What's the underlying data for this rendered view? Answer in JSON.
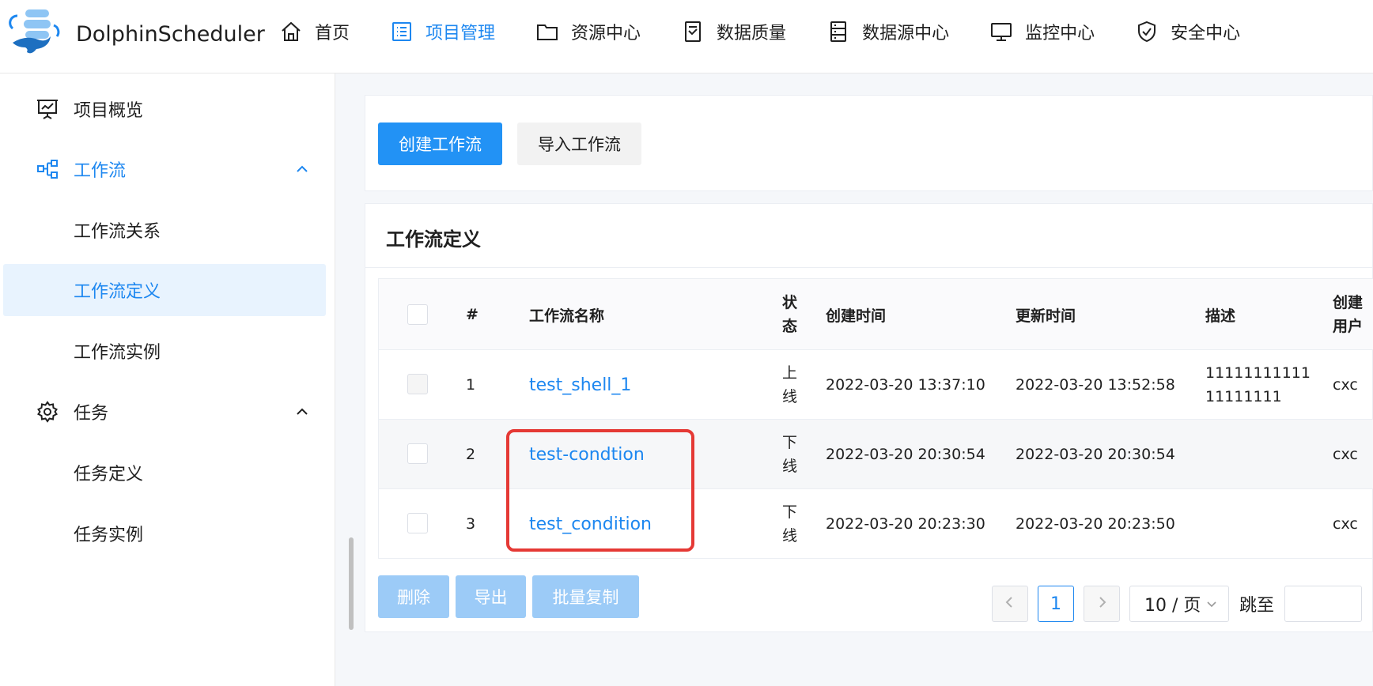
{
  "app": {
    "name": "DolphinScheduler"
  },
  "colors": {
    "accent": "#1d87f0",
    "primary_button": "#2292f5",
    "disabled_button": "#9ccbf7",
    "highlight": "#e53935"
  },
  "nav": [
    {
      "label": "首页",
      "icon": "home-icon"
    },
    {
      "label": "项目管理",
      "icon": "list-icon",
      "active": true
    },
    {
      "label": "资源中心",
      "icon": "folder-icon"
    },
    {
      "label": "数据质量",
      "icon": "document-check-icon"
    },
    {
      "label": "数据源中心",
      "icon": "database-icon"
    },
    {
      "label": "监控中心",
      "icon": "monitor-icon"
    },
    {
      "label": "安全中心",
      "icon": "shield-icon"
    }
  ],
  "sidebar": {
    "overview": "项目概览",
    "workflow": "工作流",
    "workflow_relation": "工作流关系",
    "workflow_definition": "工作流定义",
    "workflow_instance": "工作流实例",
    "task": "任务",
    "task_definition": "任务定义",
    "task_instance": "任务实例"
  },
  "toolbar": {
    "create": "创建工作流",
    "import": "导入工作流"
  },
  "card": {
    "title": "工作流定义"
  },
  "table": {
    "columns": {
      "index": "#",
      "name": "工作流名称",
      "state_1": "状",
      "state_2": "态",
      "create_time": "创建时间",
      "update_time": "更新时间",
      "desc": "描述",
      "user_1": "创建",
      "user_2": "用户"
    },
    "rows": [
      {
        "index": "1",
        "name": "test_shell_1",
        "state_1": "上",
        "state_2": "线",
        "create_time": "2022-03-20 13:37:10",
        "update_time": "2022-03-20 13:52:58",
        "desc_1": "11111111111",
        "desc_2": "11111111",
        "user": "cxc"
      },
      {
        "index": "2",
        "name": "test-condtion",
        "state_1": "下",
        "state_2": "线",
        "create_time": "2022-03-20 20:30:54",
        "update_time": "2022-03-20 20:30:54",
        "desc_1": "",
        "desc_2": "",
        "user": "cxc"
      },
      {
        "index": "3",
        "name": "test_condition",
        "state_1": "下",
        "state_2": "线",
        "create_time": "2022-03-20 20:23:30",
        "update_time": "2022-03-20 20:23:50",
        "desc_1": "",
        "desc_2": "",
        "user": "cxc"
      }
    ]
  },
  "bulk": {
    "delete": "删除",
    "export": "导出",
    "copy": "批量复制"
  },
  "pagination": {
    "current_page": "1",
    "page_size": "10 / 页",
    "jump_label": "跳至"
  }
}
